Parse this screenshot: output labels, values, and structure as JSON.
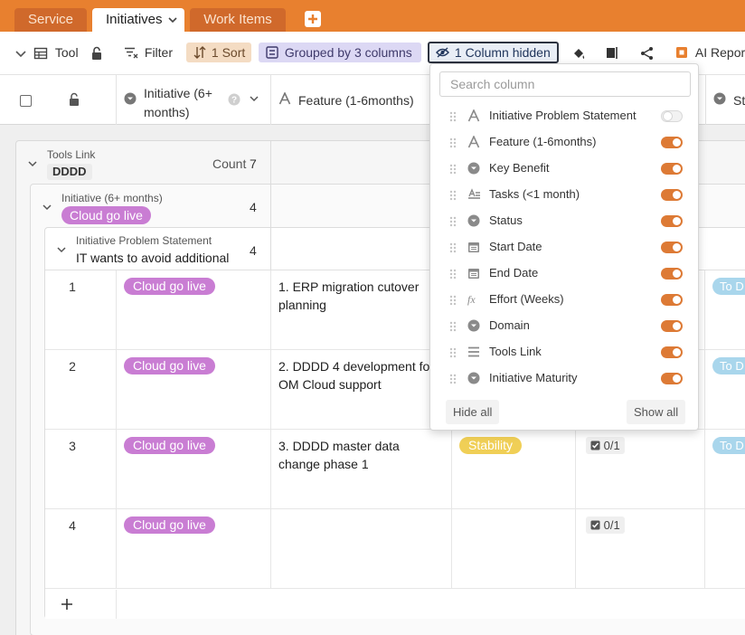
{
  "colors": {
    "brand": "#e8802f",
    "toggle_on": "#dd7a35",
    "initiative_pill": "#c97dd3",
    "stability_pill": "#f0cf56",
    "status_pill": "#a9d6ec"
  },
  "tabs": [
    {
      "label": "Service",
      "active": false
    },
    {
      "label": "Initiatives",
      "active": true
    },
    {
      "label": "Work Items",
      "active": false
    }
  ],
  "toolbar": {
    "tool_label": "Tool",
    "filter_label": "Filter",
    "sort_label": "1 Sort",
    "group_label": "Grouped by 3 columns",
    "hidden_label": "1 Column hidden",
    "ai_label": "AI Repor"
  },
  "columns": {
    "initiative": "Initiative (6+ months)",
    "feature": "Feature (1-6months)",
    "status_partial": "St"
  },
  "groups": {
    "level1": {
      "label": "Tools Link",
      "value": "DDDD",
      "count_label": "Count",
      "count": "7"
    },
    "level2": {
      "label": "Initiative (6+ months)",
      "value": "Cloud go live",
      "count": "4"
    },
    "level3": {
      "label": "Initiative Problem Statement",
      "value": "IT wants to avoid additional",
      "count": "4"
    }
  },
  "rows": [
    {
      "num": "1",
      "initiative": "Cloud go live",
      "feature": "1. ERP migration cutover planning",
      "benefit": "",
      "tasks": "",
      "status": "To D"
    },
    {
      "num": "2",
      "initiative": "Cloud go live",
      "feature": "2. DDDD 4 development fo OM Cloud support",
      "benefit": "",
      "tasks": "",
      "status": "To D"
    },
    {
      "num": "3",
      "initiative": "Cloud go live",
      "feature": "3. DDDD master data change phase 1",
      "benefit": "Stability",
      "tasks": "0/1",
      "status": "To D"
    },
    {
      "num": "4",
      "initiative": "Cloud go live",
      "feature": "",
      "benefit": "",
      "tasks": "0/1",
      "status": ""
    }
  ],
  "popup": {
    "search_placeholder": "Search column",
    "items": [
      {
        "label": "Initiative Problem Statement",
        "icon": "text-icon",
        "visible": false
      },
      {
        "label": "Feature (1-6months)",
        "icon": "text-icon",
        "visible": true
      },
      {
        "label": "Key Benefit",
        "icon": "single-select-icon",
        "visible": true
      },
      {
        "label": "Tasks (<1 month)",
        "icon": "link-icon",
        "visible": true
      },
      {
        "label": "Status",
        "icon": "single-select-icon",
        "visible": true
      },
      {
        "label": "Start Date",
        "icon": "calendar-icon",
        "visible": true
      },
      {
        "label": "End Date",
        "icon": "calendar-icon",
        "visible": true
      },
      {
        "label": "Effort (Weeks)",
        "icon": "formula-icon",
        "visible": true
      },
      {
        "label": "Domain",
        "icon": "single-select-icon",
        "visible": true
      },
      {
        "label": "Tools Link",
        "icon": "long-text-icon",
        "visible": true
      },
      {
        "label": "Initiative Maturity",
        "icon": "single-select-icon",
        "visible": true
      }
    ],
    "hide_all": "Hide all",
    "show_all": "Show all"
  }
}
